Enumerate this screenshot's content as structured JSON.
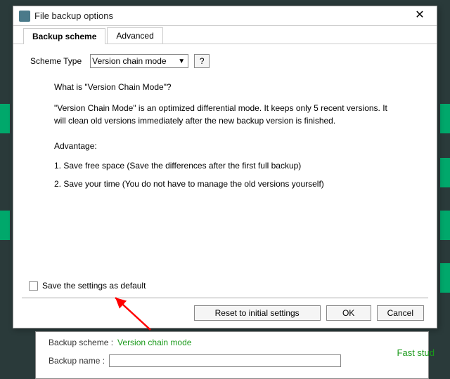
{
  "title": "File backup options",
  "tabs": {
    "scheme": "Backup scheme",
    "advanced": "Advanced"
  },
  "scheme": {
    "label": "Scheme Type",
    "selected": "Version chain mode",
    "help": "?"
  },
  "desc": {
    "heading": "What is \"Version Chain Mode\"?",
    "body": "\"Version Chain Mode\" is an optimized differential mode. It keeps only 5 recent versions. It will clean old versions immediately after the new backup version is finished.",
    "adv_heading": "Advantage:",
    "adv1": "1. Save free space (Save the differences after the first full backup)",
    "adv2": "2. Save your time (You do not have to manage the old versions yourself)"
  },
  "save_default": "Save the settings as default",
  "buttons": {
    "reset": "Reset to initial settings",
    "ok": "OK",
    "cancel": "Cancel"
  },
  "under": {
    "scheme_lbl": "Backup scheme :",
    "scheme_val": "Version chain mode",
    "name_lbl": "Backup name :"
  },
  "fast_stud": "Fast stud"
}
